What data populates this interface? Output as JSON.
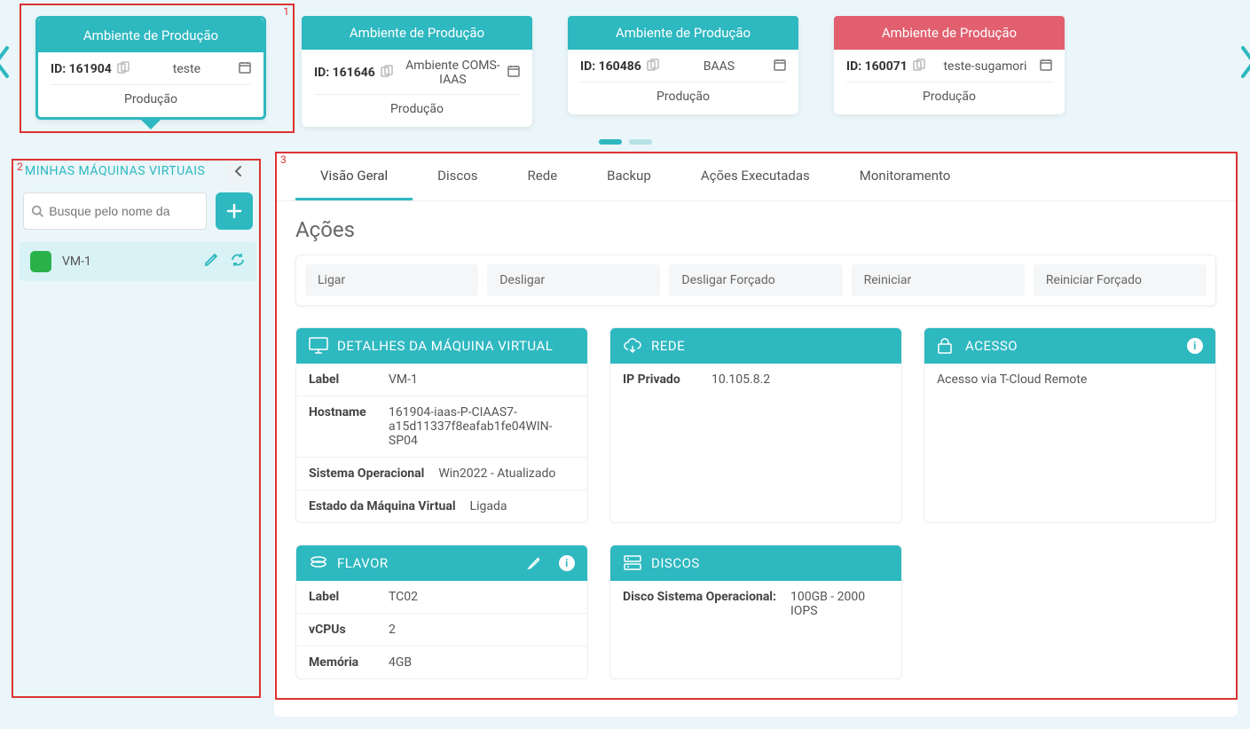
{
  "colors": {
    "primary": "#2eb8c0",
    "danger": "#e15f6f",
    "status_ok": "#2ab24a"
  },
  "environments": [
    {
      "title": "Ambiente de Produção",
      "id_label": "ID:",
      "id": "161904",
      "name": "teste",
      "subtype": "Produção",
      "selected": true,
      "alert": false
    },
    {
      "title": "Ambiente de Produção",
      "id_label": "ID:",
      "id": "161646",
      "name": "Ambiente COMS-IAAS",
      "subtype": "Produção",
      "selected": false,
      "alert": false
    },
    {
      "title": "Ambiente de Produção",
      "id_label": "ID:",
      "id": "160486",
      "name": "BAAS",
      "subtype": "Produção",
      "selected": false,
      "alert": false
    },
    {
      "title": "Ambiente de Produção",
      "id_label": "ID:",
      "id": "160071",
      "name": "teste-sugamori",
      "subtype": "Produção",
      "selected": false,
      "alert": true
    }
  ],
  "sidebar": {
    "title": "MINHAS MÁQUINAS VIRTUAIS",
    "search_placeholder": "Busque pelo nome da",
    "items": [
      {
        "name": "VM-1",
        "status": "running"
      }
    ]
  },
  "tabs": [
    {
      "label": "Visão Geral",
      "active": true
    },
    {
      "label": "Discos"
    },
    {
      "label": "Rede"
    },
    {
      "label": "Backup"
    },
    {
      "label": "Ações Executadas"
    },
    {
      "label": "Monitoramento"
    }
  ],
  "actions": {
    "heading": "Ações",
    "buttons": [
      {
        "label": "Ligar"
      },
      {
        "label": "Desligar"
      },
      {
        "label": "Desligar Forçado"
      },
      {
        "label": "Reiniciar"
      },
      {
        "label": "Reiniciar Forçado"
      }
    ]
  },
  "panels": {
    "details": {
      "title": "DETALHES DA MÁQUINA VIRTUAL",
      "rows": [
        {
          "k": "Label",
          "v": "VM-1"
        },
        {
          "k": "Hostname",
          "v": "161904-iaas-P-CIAAS7-a15d11337f8eafab1fe04WIN-SP04"
        },
        {
          "k": "Sistema Operacional",
          "v": "Win2022 - Atualizado"
        },
        {
          "k": "Estado da Máquina Virtual",
          "v": "Ligada"
        }
      ]
    },
    "network": {
      "title": "REDE",
      "rows": [
        {
          "k": "IP Privado",
          "v": "10.105.8.2"
        }
      ]
    },
    "access": {
      "title": "ACESSO",
      "text": "Acesso via T-Cloud Remote"
    },
    "flavor": {
      "title": "FLAVOR",
      "rows": [
        {
          "k": "Label",
          "v": "TC02"
        },
        {
          "k": "vCPUs",
          "v": "2"
        },
        {
          "k": "Memória",
          "v": "4GB"
        }
      ]
    },
    "disks": {
      "title": "DISCOS",
      "rows": [
        {
          "k": "Disco Sistema Operacional:",
          "v": "100GB - 2000 IOPS"
        }
      ]
    }
  }
}
